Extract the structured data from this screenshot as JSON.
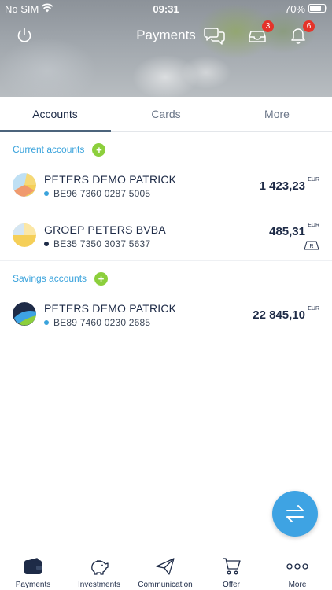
{
  "status_bar": {
    "carrier": "No SIM",
    "time": "09:31",
    "battery": "70%"
  },
  "header": {
    "title": "Payments",
    "inbox_badge": "3",
    "notifications_badge": "6"
  },
  "tabs": [
    {
      "label": "Accounts",
      "active": true
    },
    {
      "label": "Cards",
      "active": false
    },
    {
      "label": "More",
      "active": false
    }
  ],
  "sections": {
    "current": {
      "label": "Current accounts",
      "add_icon": "+",
      "accounts": [
        {
          "name": "PETERS DEMO PATRICK",
          "iban": "BE96 7360 0287 5005",
          "amount": "1 423,23",
          "currency": "EUR",
          "dot_color": "#3aa3dc"
        },
        {
          "name": "GROEP PETERS BVBA",
          "iban": "BE35 7350 3037 5637",
          "amount": "485,31",
          "currency": "EUR",
          "dot_color": "#1e2b47",
          "card_icon_letter": "R"
        }
      ]
    },
    "savings": {
      "label": "Savings accounts",
      "add_icon": "+",
      "accounts": [
        {
          "name": "PETERS DEMO PATRICK",
          "iban": "BE89 7460 0230 2685",
          "amount": "22 845,10",
          "currency": "EUR",
          "dot_color": "#3aa3dc"
        }
      ]
    }
  },
  "fab": {
    "icon": "transfer-arrows-icon"
  },
  "bottom_nav": [
    {
      "label": "Payments",
      "icon": "wallet-icon",
      "active": true
    },
    {
      "label": "Investments",
      "icon": "piggy-bank-icon",
      "active": false
    },
    {
      "label": "Communication",
      "icon": "paper-plane-icon",
      "active": false
    },
    {
      "label": "Offer",
      "icon": "cart-icon",
      "active": false
    },
    {
      "label": "More",
      "icon": "more-dots-icon",
      "active": false
    }
  ],
  "colors": {
    "accent": "#3aa3dc",
    "navy": "#1e2b47",
    "add_green": "#8ccf3c",
    "badge_red": "#e5332a",
    "fab_blue": "#3ea3e3"
  }
}
